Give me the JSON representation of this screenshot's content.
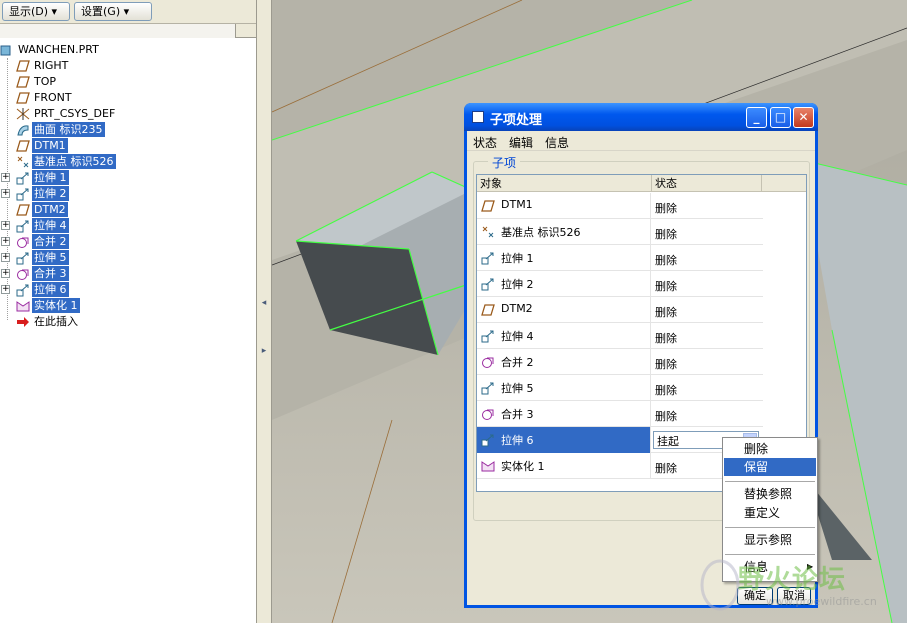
{
  "toolbar": {
    "show_label": "显示(D) ▾",
    "settings_label": "设置(G) ▾"
  },
  "tree": {
    "root": "WANCHEN.PRT",
    "items": [
      {
        "label": "RIGHT",
        "icon": "datum-plane-icon",
        "selected": false
      },
      {
        "label": "TOP",
        "icon": "datum-plane-icon",
        "selected": false
      },
      {
        "label": "FRONT",
        "icon": "datum-plane-icon",
        "selected": false
      },
      {
        "label": "PRT_CSYS_DEF",
        "icon": "csys-icon",
        "selected": false
      },
      {
        "label": "曲面 标识235",
        "icon": "surface-icon",
        "selected": true
      },
      {
        "label": "DTM1",
        "icon": "datum-plane-icon",
        "selected": true
      },
      {
        "label": "基准点 标识526",
        "icon": "datum-point-icon",
        "selected": true
      },
      {
        "label": "拉伸 1",
        "icon": "extrude-icon",
        "selected": true
      },
      {
        "label": "拉伸 2",
        "icon": "extrude-icon",
        "selected": true
      },
      {
        "label": "DTM2",
        "icon": "datum-plane-icon",
        "selected": true
      },
      {
        "label": "拉伸 4",
        "icon": "extrude-icon",
        "selected": true
      },
      {
        "label": "合并 2",
        "icon": "merge-icon",
        "selected": true
      },
      {
        "label": "拉伸 5",
        "icon": "extrude-icon",
        "selected": true
      },
      {
        "label": "合并 3",
        "icon": "merge-icon",
        "selected": true
      },
      {
        "label": "拉伸 6",
        "icon": "extrude-icon",
        "selected": true
      },
      {
        "label": "实体化 1",
        "icon": "solidify-icon",
        "selected": true
      },
      {
        "label": "在此插入",
        "icon": "insert-here-icon",
        "selected": false
      }
    ]
  },
  "dialog": {
    "title": "子项处理",
    "menu": [
      "状态",
      "编辑",
      "信息"
    ],
    "group_label": "子项",
    "columns": [
      "对象",
      "状态"
    ],
    "rows": [
      {
        "name": "DTM1",
        "status": "删除",
        "icon": "datum-plane-icon"
      },
      {
        "name": "基准点 标识526",
        "status": "删除",
        "icon": "datum-point-icon"
      },
      {
        "name": "拉伸 1",
        "status": "删除",
        "icon": "extrude-icon"
      },
      {
        "name": "拉伸 2",
        "status": "删除",
        "icon": "extrude-icon"
      },
      {
        "name": "DTM2",
        "status": "删除",
        "icon": "datum-plane-icon"
      },
      {
        "name": "拉伸 4",
        "status": "删除",
        "icon": "extrude-icon"
      },
      {
        "name": "合并 2",
        "status": "删除",
        "icon": "merge-icon"
      },
      {
        "name": "拉伸 5",
        "status": "删除",
        "icon": "extrude-icon"
      },
      {
        "name": "合并 3",
        "status": "删除",
        "icon": "merge-icon"
      },
      {
        "name": "拉伸 6",
        "status": "挂起",
        "icon": "extrude-icon"
      },
      {
        "name": "实体化 1",
        "status": "删除",
        "icon": "solidify-icon"
      }
    ],
    "ok_label": "确定",
    "cancel_label": "取消"
  },
  "popup_menu": {
    "items": [
      "删除",
      "保留",
      "替换参照",
      "重定义",
      "显示参照",
      "信息"
    ],
    "selected": "保留"
  },
  "watermark": {
    "text": "野火论坛",
    "url": "www.proewildfire.cn"
  },
  "colors": {
    "selection": "#316ac5",
    "title_bar": "#0058ee",
    "model_edge": "#33ff33",
    "viewport_bg": "#b8b5a8"
  }
}
